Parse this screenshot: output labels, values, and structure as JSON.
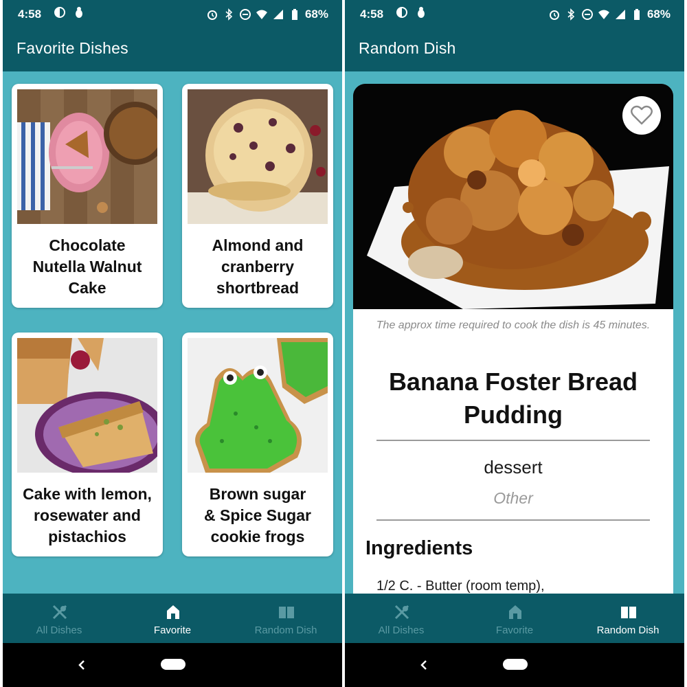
{
  "colors": {
    "primary_dark": "#0c5a66",
    "content_bg": "#4db3c0",
    "nav_inactive": "#5a9aa3",
    "nav_active": "#ffffff",
    "card_bg": "#ffffff"
  },
  "status_bar": {
    "time": "4:58",
    "battery": "68%",
    "left_icons": [
      "media-icon",
      "android-debug-icon"
    ],
    "right_icons": [
      "alarm-icon",
      "bluetooth-icon",
      "do-not-disturb-icon",
      "wifi-icon",
      "signal-icon",
      "battery-icon"
    ]
  },
  "favorite_screen": {
    "title": "Favorite Dishes",
    "dishes": [
      {
        "title_lines": [
          "Chocolate",
          "Nutella Walnut",
          "Cake"
        ]
      },
      {
        "title_lines": [
          "Almond and",
          "cranberry",
          "shortbread"
        ]
      },
      {
        "title_lines": [
          "Cake with lemon,",
          "rosewater and",
          "pistachios"
        ]
      },
      {
        "title_lines": [
          "Brown sugar",
          "& Spice Sugar",
          "cookie frogs"
        ]
      }
    ]
  },
  "random_screen": {
    "title": "Random Dish",
    "cook_time": "The approx time required to cook the dish is 45 minutes.",
    "dish_title": "Banana Foster Bread Pudding",
    "dish_type": "dessert",
    "dish_category": "Other",
    "ingredients_heading": "Ingredients",
    "first_ingredient": "1/2 C. - Butter (room temp),"
  },
  "bottom_nav": {
    "items": [
      {
        "label": "All Dishes",
        "icon": "cutlery-icon"
      },
      {
        "label": "Favorite",
        "icon": "home-icon"
      },
      {
        "label": "Random Dish",
        "icon": "book-icon"
      }
    ]
  }
}
